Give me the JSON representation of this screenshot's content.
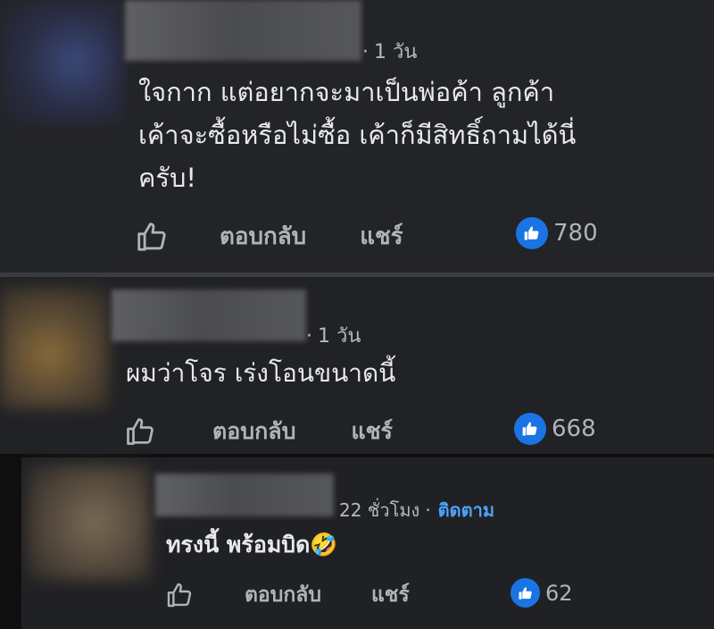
{
  "comments": [
    {
      "time": "1 วัน",
      "lines": [
        "ใจกาก แต่อยากจะมาเป็นพ่อค้า ลูกค้า",
        "เค้าจะซื้อหรือไม่ซื้อ เค้าก็มีสิทธิ์ถามได้นี่",
        "ครับ!"
      ],
      "reply_label": "ตอบกลับ",
      "share_label": "แชร์",
      "likes": "780"
    },
    {
      "time": "1 วัน",
      "lines": [
        "ผมว่าโจร เร่งโอนขนาดนี้"
      ],
      "reply_label": "ตอบกลับ",
      "share_label": "แชร์",
      "likes": "668"
    },
    {
      "time": "22 ชั่วโมง",
      "follow": "ติดตาม",
      "lines": [
        "ทรงนี้ พร้อมบิด"
      ],
      "emoji": "🤣",
      "reply_label": "ตอบกลับ",
      "share_label": "แชร์",
      "likes": "62"
    }
  ],
  "icons": {
    "like_outline": "thumbs-up-outline-icon",
    "like_badge": "thumbs-up-badge-icon",
    "emoji": "rolling-laughing-emoji"
  },
  "colors": {
    "background": "#1f2023",
    "text": "#e8e9eb",
    "muted": "#b0b3b8",
    "like_blue": "#1b74e4",
    "follow_blue": "#4da3ff"
  }
}
